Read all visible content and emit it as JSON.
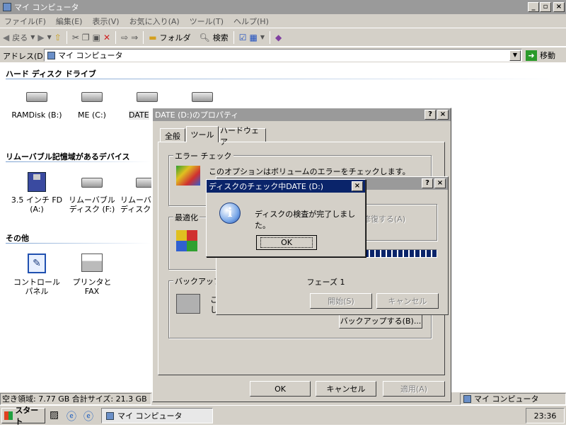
{
  "window": {
    "title": "マイ コンピュータ"
  },
  "menu": [
    "ファイル(F)",
    "編集(E)",
    "表示(V)",
    "お気に入り(A)",
    "ツール(T)",
    "ヘルプ(H)"
  ],
  "toolbar": {
    "back": "戻る",
    "folders": "フォルダ",
    "search": "検索"
  },
  "address": {
    "label": "アドレス(D)",
    "value": "マイ コンピュータ",
    "go": "移動"
  },
  "sections": {
    "hdd": "ハード ディスク ドライブ",
    "removable": "リムーバブル記憶域があるデバイス",
    "other": "その他"
  },
  "drives": [
    "RAMDisk (B:)",
    "ME (C:)",
    "DATE",
    ""
  ],
  "removable_items": [
    "3.5 インチ FD (A:)",
    "リムーバブル ディスク (F:)",
    "リムーバブル ディスク"
  ],
  "other_items": [
    "コントロール パネル",
    "プリンタと FAX"
  ],
  "status": {
    "left": "空き領域: 7.77 GB 合計サイズ: 21.3 GB",
    "right": "マイ コンピュータ"
  },
  "taskbar": {
    "start": "スタート",
    "task": "マイ コンピュータ",
    "clock": "23:36"
  },
  "props": {
    "title": "DATE (D:)のプロパティ",
    "tabs": [
      "全般",
      "ツール",
      "ハードウェア"
    ],
    "error_check": {
      "label": "エラー チェック",
      "text": "このオプションはボリュームのエラーをチェックします。"
    },
    "optimize": {
      "label": "最適化"
    },
    "backup": {
      "label": "バックアップ",
      "text1": "こ",
      "text2": "し",
      "button": "バックアップする(B)..."
    },
    "buttons": {
      "ok": "OK",
      "cancel": "キャンセル",
      "apply": "適用(A)"
    }
  },
  "check_dialog": {
    "repair": "修復する(A)",
    "phase": "フェーズ 1",
    "start": "開始(S)",
    "cancel": "キャンセル",
    "progress": 1.0
  },
  "msgbox": {
    "title": "ディスクのチェック中DATE (D:)",
    "text": "ディスクの検査が完了しました。",
    "ok": "OK"
  },
  "colors": {
    "active_title": "#0a246a",
    "inactive_title": "#9a9a9a",
    "face": "#d4d0c8",
    "progress": "#0a246a"
  }
}
